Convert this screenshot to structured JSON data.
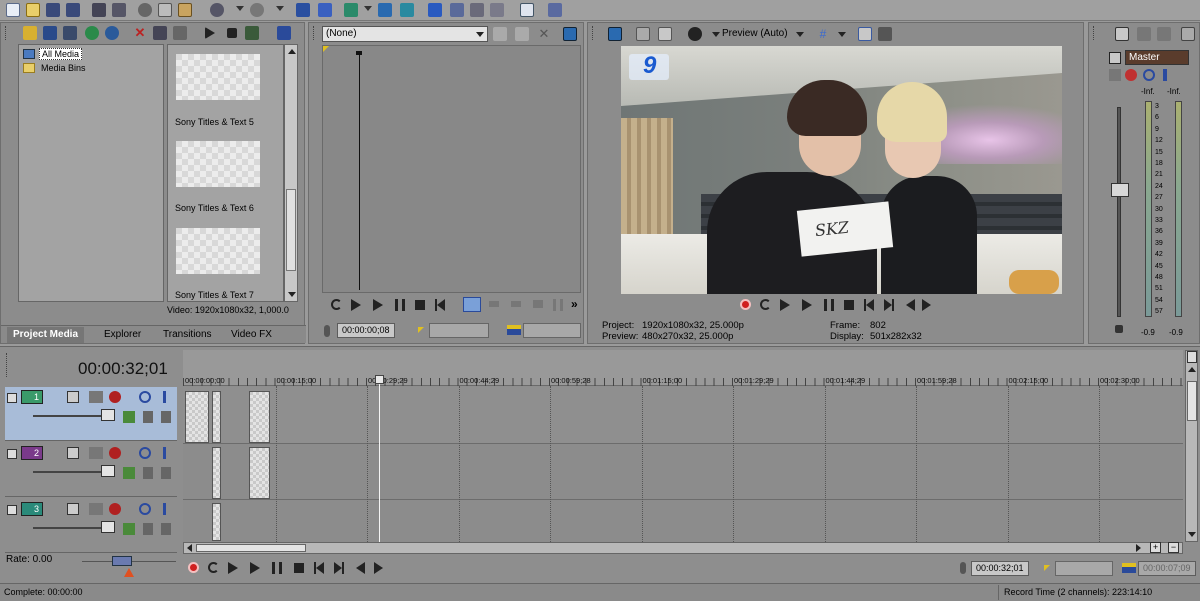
{
  "toolbar": {
    "icons": [
      "new-icon",
      "open-icon",
      "save-icon",
      "save-as-icon",
      "render-icon",
      "properties-icon",
      "cut-icon",
      "copy-icon",
      "paste-icon",
      "undo-icon",
      "redo-icon",
      "normal-edit-tool-icon",
      "envelope-tool-icon",
      "selection-tool-icon",
      "zoom-tool-icon",
      "snapping-icon",
      "auto-ripple-icon",
      "lock-envelopes-icon",
      "ignore-grouping-icon",
      "help-icon"
    ]
  },
  "project_media": {
    "tree": [
      {
        "label": "All Media",
        "selected": true
      },
      {
        "label": "Media Bins",
        "selected": false
      }
    ],
    "thumbnails": [
      {
        "label": "Sony Titles & Text 5"
      },
      {
        "label": "Sony Titles & Text 6"
      },
      {
        "label": "Sony Titles & Text 7"
      }
    ],
    "info": "Video: 1920x1080x32, 1,000.0",
    "tabs": [
      "Project Media",
      "Explorer",
      "Transitions",
      "Video FX"
    ]
  },
  "trimmer": {
    "dropdown_value": "(None)",
    "time": "00:00:00;08"
  },
  "preview": {
    "mode_label": "Preview (Auto)",
    "channel_logo": "9",
    "card_text": "SKZ",
    "project_label": "Project:",
    "project_value": "1920x1080x32, 25.000p",
    "preview_label": "Preview:",
    "preview_value": "480x270x32, 25.000p",
    "frame_label": "Frame:",
    "frame_value": "802",
    "display_label": "Display:",
    "display_value": "501x282x32"
  },
  "master": {
    "title": "Master",
    "inf_left": "-Inf.",
    "inf_right": "-Inf.",
    "scale": [
      "3",
      "6",
      "9",
      "12",
      "15",
      "18",
      "21",
      "24",
      "27",
      "30",
      "33",
      "36",
      "39",
      "42",
      "45",
      "48",
      "51",
      "54",
      "57"
    ],
    "peak_left": "-0.9",
    "peak_right": "-0.9"
  },
  "timeline": {
    "cursor_time": "00:00:32;01",
    "ruler": [
      "00:00:00;00",
      "00:00:15;00",
      "00:00:29;29",
      "00:00:44;29",
      "00:00:59;28",
      "00:01:15;00",
      "00:01:29;29",
      "00:01:44;29",
      "00:01:59;28",
      "00:02:15;00",
      "00:02:30;00"
    ],
    "tracks": [
      {
        "number": "1",
        "color": "#3a9a6a",
        "selected": true
      },
      {
        "number": "2",
        "color": "#7a3a8a",
        "selected": false
      },
      {
        "number": "3",
        "color": "#2a8a7a",
        "selected": false
      }
    ],
    "rate": "Rate: 0.00",
    "bottom_time": "00:00:32;01",
    "bottom_time2": "00:00:07;09"
  },
  "status": {
    "left": "Complete: 00:00:00",
    "right": "Record Time (2 channels): 223:14:10"
  }
}
